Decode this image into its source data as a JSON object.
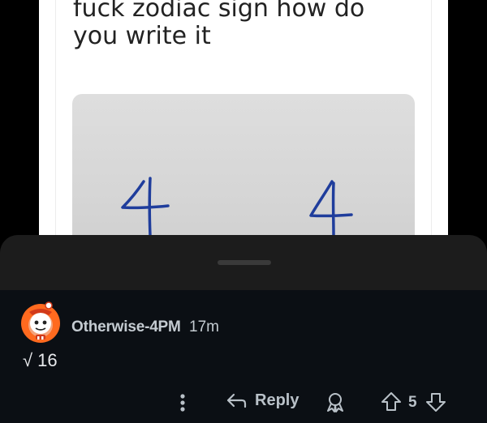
{
  "post": {
    "title": "fuck zodiac sign how do you write it"
  },
  "comment": {
    "username": "Otherwise-4PM",
    "timestamp": "17m",
    "body": "√ 16",
    "actions": {
      "reply_label": "Reply",
      "vote_count": "5"
    }
  },
  "icons": {
    "more": "more-vertical-icon",
    "reply": "reply-arrow-icon",
    "award": "award-icon",
    "upvote": "upvote-arrow-icon",
    "downvote": "downvote-arrow-icon"
  },
  "colors": {
    "page_bg": "#000000",
    "sheet_bg": "#1c1c1c",
    "comment_bg": "#0b0f14",
    "ink_blue": "#1f3d9c",
    "avatar_orange": "#ff6a1f"
  }
}
